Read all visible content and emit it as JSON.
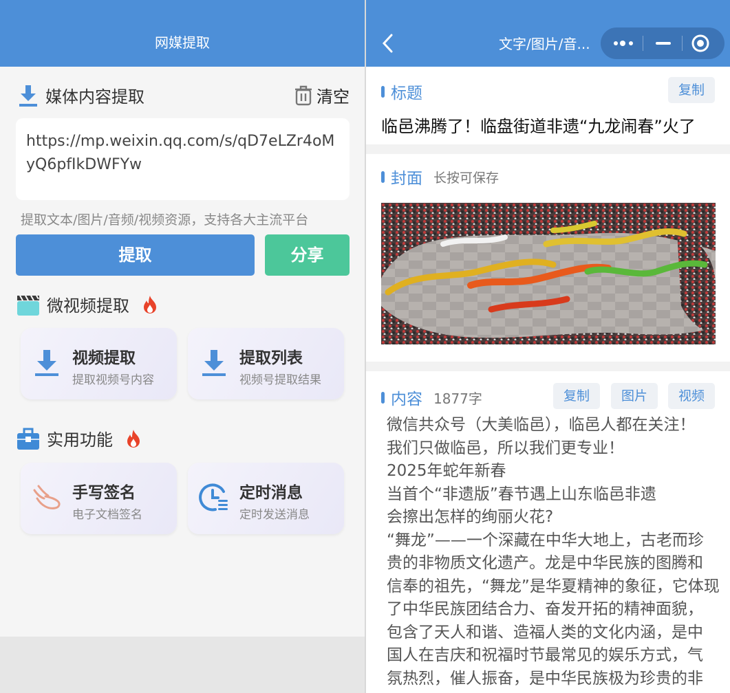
{
  "left": {
    "header_title": "网媒提取",
    "media_section_title": "媒体内容提取",
    "clear_label": "清空",
    "url_value": "https://mp.weixin.qq.com/s/qD7eLZr4oMyQ6pfIkDWFYw",
    "url_line1": "https://mp.weixin.qq.com/s/qD7eLZr4oM",
    "url_line2": "yQ6pfIkDWFYw",
    "hint": "提取文本/图片/音频/视频资源，支持各大主流平台",
    "extract_button": "提取",
    "share_button": "分享",
    "video_section_title": "微视频提取",
    "video_cards": [
      {
        "title": "视频提取",
        "subtitle": "提取视频号内容",
        "icon": "download-icon"
      },
      {
        "title": "提取列表",
        "subtitle": "视频号提取结果",
        "icon": "download-icon"
      }
    ],
    "tools_section_title": "实用功能",
    "tool_cards": [
      {
        "title": "手写签名",
        "subtitle": "电子文档签名",
        "icon": "signature-hand-icon"
      },
      {
        "title": "定时消息",
        "subtitle": "定时发送消息",
        "icon": "clock-list-icon"
      }
    ]
  },
  "right": {
    "header_title": "文字/图片/音...",
    "title_label": "标题",
    "copy_label": "复制",
    "title_text": "临邑沸腾了！临盘街道非遗“九龙闹春”火了",
    "cover_label": "封面",
    "cover_hint": "长按可保存",
    "content_label": "内容",
    "content_count": "1877字",
    "content_buttons": [
      "复制",
      "图片",
      "视频"
    ],
    "content_lines": [
      "微信共众号（大美临邑），临邑人都在关注！",
      "我们只做临邑，所以我们更专业！",
      "2025年蛇年新春",
      "当首个“非遗版”春节遇上山东临邑非遗",
      "会擦出怎样的绚丽火花?",
      "“舞龙”——一个深藏在中华大地上，古老而珍",
      "贵的非物质文化遗产。龙是中华民族的图腾和",
      "信奉的祖先，“舞龙”是华夏精神的象征，它体现",
      "了中华民族团结合力、奋发开拓的精神面貌，",
      "包含了天人和谐、造福人类的文化内涵，是中",
      "国人在吉庆和祝福时节最常见的娱乐方式，气",
      "氛热烈，催人振奋，是中华民族极为珍贵的非"
    ]
  },
  "colors": {
    "header": "#4d8fd8",
    "primary": "#4d8fd8",
    "share": "#4cc79a",
    "fire": "#e8432a"
  }
}
